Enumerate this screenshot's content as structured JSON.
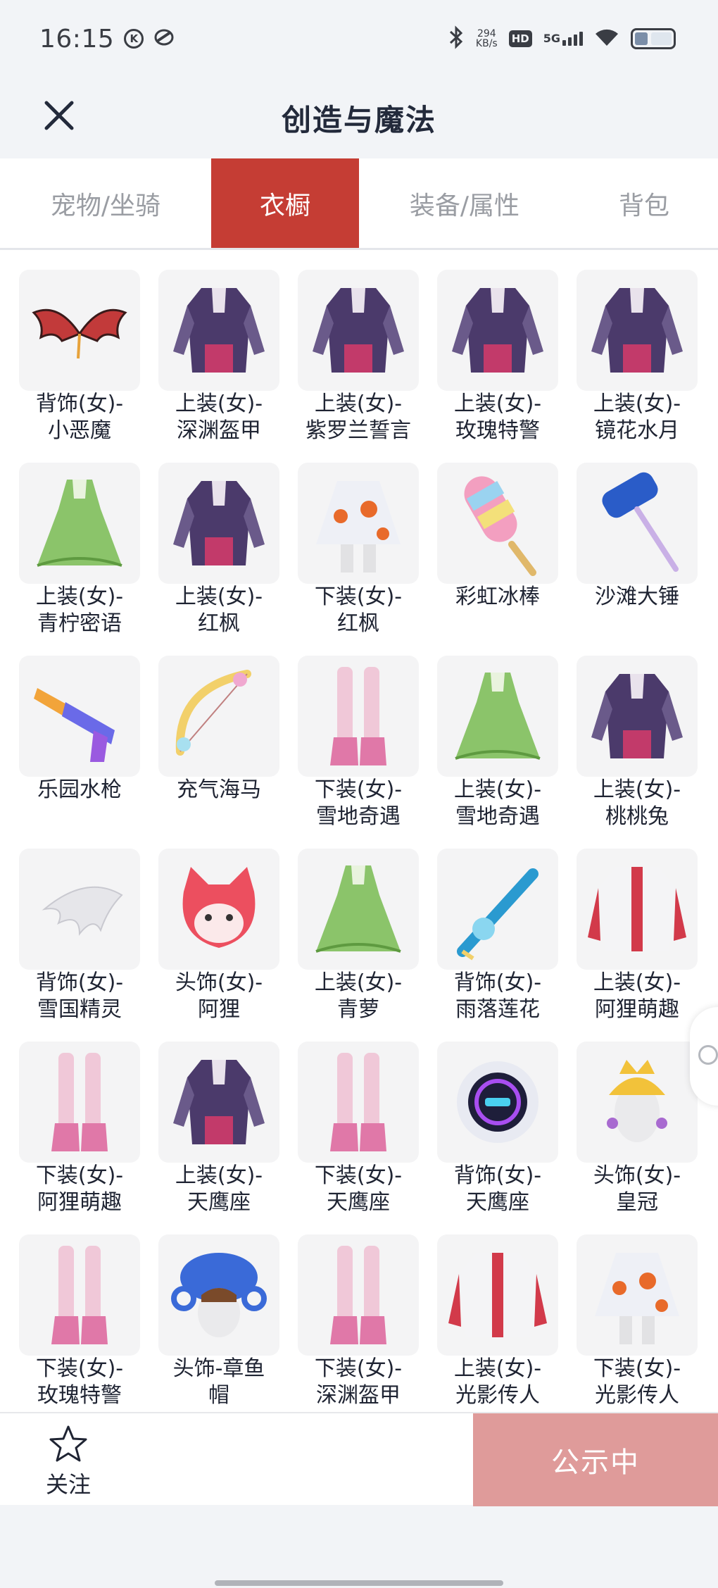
{
  "status_bar": {
    "time": "16:15",
    "net_speed_value": "294",
    "net_speed_unit": "KB/s",
    "hd_label": "HD",
    "network_label": "5G"
  },
  "header": {
    "title": "创造与魔法"
  },
  "tabs": [
    {
      "label": "宠物/坐骑",
      "active": false
    },
    {
      "label": "衣橱",
      "active": true
    },
    {
      "label": "装备/属性",
      "active": false
    },
    {
      "label": "背包",
      "active": false
    }
  ],
  "items": [
    {
      "name": "背饰(女)-\n小恶魔",
      "icon": "wings-icon"
    },
    {
      "name": "上装(女)-\n深渊盔甲",
      "icon": "top-icon"
    },
    {
      "name": "上装(女)-\n紫罗兰誓言",
      "icon": "top-icon"
    },
    {
      "name": "上装(女)-\n玫瑰特警",
      "icon": "top-icon"
    },
    {
      "name": "上装(女)-\n镜花水月",
      "icon": "top-icon"
    },
    {
      "name": "上装(女)-\n青柠密语",
      "icon": "dress-icon"
    },
    {
      "name": "上装(女)-\n红枫",
      "icon": "top-icon"
    },
    {
      "name": "下装(女)-\n红枫",
      "icon": "skirt-icon"
    },
    {
      "name": "彩虹冰棒",
      "icon": "popsicle-icon"
    },
    {
      "name": "沙滩大锤",
      "icon": "hammer-icon"
    },
    {
      "name": "乐园水枪",
      "icon": "water-gun-icon"
    },
    {
      "name": "充气海马",
      "icon": "bow-icon"
    },
    {
      "name": "下装(女)-\n雪地奇遇",
      "icon": "boots-icon"
    },
    {
      "name": "上装(女)-\n雪地奇遇",
      "icon": "dress-icon"
    },
    {
      "name": "上装(女)-\n桃桃兔",
      "icon": "top-icon"
    },
    {
      "name": "背饰(女)-\n雪国精灵",
      "icon": "wing-icon"
    },
    {
      "name": "头饰(女)-\n阿狸",
      "icon": "fox-head-icon"
    },
    {
      "name": "上装(女)-\n青萝",
      "icon": "dress-icon"
    },
    {
      "name": "背饰(女)-\n雨落莲花",
      "icon": "sword-icon"
    },
    {
      "name": "上装(女)-\n阿狸萌趣",
      "icon": "jacket-icon"
    },
    {
      "name": "下装(女)-\n阿狸萌趣",
      "icon": "boots-icon"
    },
    {
      "name": "上装(女)-\n天鹰座",
      "icon": "top-icon"
    },
    {
      "name": "下装(女)-\n天鹰座",
      "icon": "boots-icon"
    },
    {
      "name": "背饰(女)-\n天鹰座",
      "icon": "robot-icon"
    },
    {
      "name": "头饰(女)-\n皇冠",
      "icon": "crown-head-icon"
    },
    {
      "name": "下装(女)-\n玫瑰特警",
      "icon": "boots-icon"
    },
    {
      "name": "头饰-章鱼\n帽",
      "icon": "octopus-hat-icon"
    },
    {
      "name": "下装(女)-\n深渊盔甲",
      "icon": "boots-icon"
    },
    {
      "name": "上装(女)-\n光影传人",
      "icon": "jacket-icon"
    },
    {
      "name": "下装(女)-\n光影传人",
      "icon": "skirt-icon"
    }
  ],
  "bottom_bar": {
    "follow_label": "关注",
    "status_label": "公示中"
  },
  "colors": {
    "accent": "#c53d34",
    "status_button": "#df9b9a",
    "background": "#f2f4f7"
  }
}
